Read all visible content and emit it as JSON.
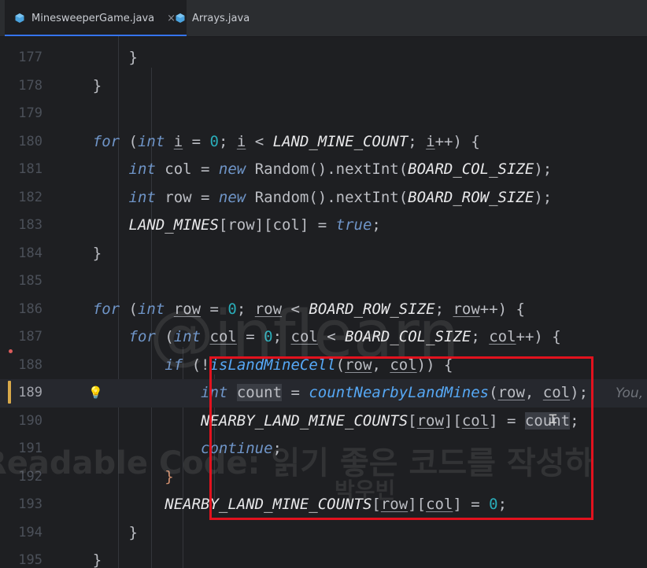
{
  "tabs": [
    {
      "label": "MinesweeperGame.java",
      "active": true,
      "close": "×"
    },
    {
      "label": "Arrays.java",
      "active": false
    }
  ],
  "colors": {
    "accent": "#3574f0",
    "highlight_box": "#e2121e",
    "modified_marker": "#d8a94a"
  },
  "editor": {
    "current_line": "189",
    "inlay_hint": "You,",
    "lines": [
      {
        "n": "177",
        "tokens": [
          [
            "",
            "        }"
          ]
        ]
      },
      {
        "n": "178",
        "tokens": [
          [
            "",
            "    }"
          ]
        ]
      },
      {
        "n": "179",
        "tokens": []
      },
      {
        "n": "180",
        "tokens": [
          [
            "",
            "    "
          ],
          [
            "kw",
            "for"
          ],
          [
            "",
            " ("
          ],
          [
            "kw",
            "int"
          ],
          [
            "",
            " "
          ],
          [
            "ul",
            "i"
          ],
          [
            "",
            " = "
          ],
          [
            "num",
            "0"
          ],
          [
            "",
            "; "
          ],
          [
            "ul",
            "i"
          ],
          [
            "",
            " < "
          ],
          [
            "const",
            "LAND_MINE_COUNT"
          ],
          [
            "",
            "; "
          ],
          [
            "ul",
            "i"
          ],
          [
            "",
            "++) {"
          ]
        ]
      },
      {
        "n": "181",
        "tokens": [
          [
            "",
            "        "
          ],
          [
            "kw",
            "int"
          ],
          [
            "",
            " col = "
          ],
          [
            "kw",
            "new"
          ],
          [
            "",
            " Random().nextInt("
          ],
          [
            "const",
            "BOARD_COL_SIZE"
          ],
          [
            "",
            ");"
          ]
        ]
      },
      {
        "n": "182",
        "tokens": [
          [
            "",
            "        "
          ],
          [
            "kw",
            "int"
          ],
          [
            "",
            " row = "
          ],
          [
            "kw",
            "new"
          ],
          [
            "",
            " Random().nextInt("
          ],
          [
            "const",
            "BOARD_ROW_SIZE"
          ],
          [
            "",
            ");"
          ]
        ]
      },
      {
        "n": "183",
        "tokens": [
          [
            "",
            "        "
          ],
          [
            "const",
            "LAND_MINES"
          ],
          [
            "",
            "[row][col] = "
          ],
          [
            "kw",
            "true"
          ],
          [
            "",
            ";"
          ]
        ]
      },
      {
        "n": "184",
        "tokens": [
          [
            "",
            "    }"
          ]
        ]
      },
      {
        "n": "185",
        "tokens": []
      },
      {
        "n": "186",
        "tokens": [
          [
            "",
            "    "
          ],
          [
            "kw",
            "for"
          ],
          [
            "",
            " ("
          ],
          [
            "kw",
            "int"
          ],
          [
            "",
            " "
          ],
          [
            "ul",
            "row"
          ],
          [
            "",
            " = "
          ],
          [
            "num",
            "0"
          ],
          [
            "",
            "; "
          ],
          [
            "ul",
            "row"
          ],
          [
            "",
            " < "
          ],
          [
            "const",
            "BOARD_ROW_SIZE"
          ],
          [
            "",
            "; "
          ],
          [
            "ul",
            "row"
          ],
          [
            "",
            "++) {"
          ]
        ]
      },
      {
        "n": "187",
        "tokens": [
          [
            "",
            "        "
          ],
          [
            "kw",
            "for"
          ],
          [
            "",
            " ("
          ],
          [
            "kw",
            "int"
          ],
          [
            "",
            " "
          ],
          [
            "ul",
            "col"
          ],
          [
            "",
            " = "
          ],
          [
            "num",
            "0"
          ],
          [
            "",
            "; "
          ],
          [
            "ul",
            "col"
          ],
          [
            "",
            " < "
          ],
          [
            "const",
            "BOARD_COL_SIZE"
          ],
          [
            "",
            "; "
          ],
          [
            "ul",
            "col"
          ],
          [
            "",
            "++) {"
          ]
        ]
      },
      {
        "n": "188",
        "tokens": [
          [
            "",
            "            "
          ],
          [
            "kw",
            "if"
          ],
          [
            "",
            " (!"
          ],
          [
            "fn",
            "isLandMineCell"
          ],
          [
            "",
            "("
          ],
          [
            "ul",
            "row"
          ],
          [
            "",
            ", "
          ],
          [
            "ul",
            "col"
          ],
          [
            "",
            ")) {"
          ]
        ]
      },
      {
        "n": "189",
        "tokens": [
          [
            "",
            "                "
          ],
          [
            "kw",
            "int"
          ],
          [
            "",
            " "
          ],
          [
            "hl",
            "count"
          ],
          [
            "",
            " = "
          ],
          [
            "fn",
            "countNearbyLandMines"
          ],
          [
            "",
            "("
          ],
          [
            "ul",
            "row"
          ],
          [
            "",
            ", "
          ],
          [
            "ul",
            "col"
          ],
          [
            "",
            ");"
          ]
        ]
      },
      {
        "n": "190",
        "tokens": [
          [
            "",
            "                "
          ],
          [
            "const",
            "NEARBY_LAND_MINE_COUNTS"
          ],
          [
            "",
            "["
          ],
          [
            "ul",
            "row"
          ],
          [
            "",
            "]["
          ],
          [
            "ul",
            "col"
          ],
          [
            "",
            "] = "
          ],
          [
            "hl",
            "count"
          ],
          [
            "",
            ";"
          ]
        ]
      },
      {
        "n": "191",
        "tokens": [
          [
            "",
            "                "
          ],
          [
            "kw",
            "continue"
          ],
          [
            "",
            ";"
          ]
        ]
      },
      {
        "n": "192",
        "tokens": [
          [
            "",
            "            "
          ],
          [
            "kn",
            "}"
          ]
        ]
      },
      {
        "n": "193",
        "tokens": [
          [
            "",
            "            "
          ],
          [
            "const",
            "NEARBY_LAND_MINE_COUNTS"
          ],
          [
            "",
            "["
          ],
          [
            "ul",
            "row"
          ],
          [
            "",
            "]["
          ],
          [
            "ul",
            "col"
          ],
          [
            "",
            "] = "
          ],
          [
            "num",
            "0"
          ],
          [
            "",
            ";"
          ]
        ]
      },
      {
        "n": "194",
        "tokens": [
          [
            "",
            "        }"
          ]
        ]
      },
      {
        "n": "195",
        "tokens": [
          [
            "",
            "    }"
          ]
        ]
      }
    ]
  },
  "watermark": {
    "brand": "@inflearn",
    "course": "Readable Code: 읽기 좋은 코드를 작성하",
    "instructor": "박우빈"
  }
}
